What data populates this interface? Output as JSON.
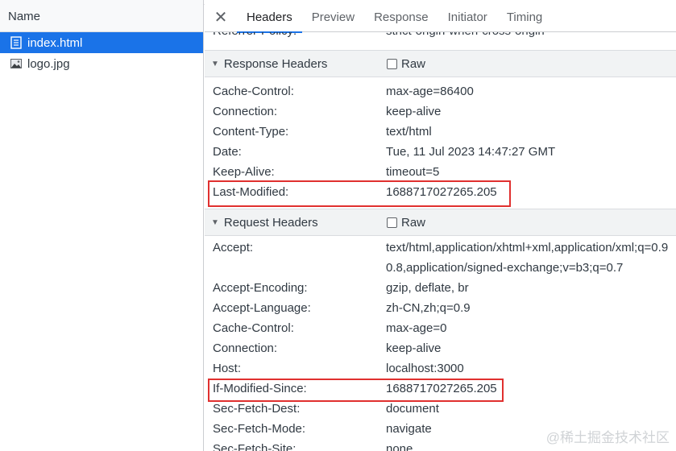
{
  "files": {
    "column_label": "Name",
    "items": [
      {
        "name": "index.html",
        "icon": "document-icon",
        "selected": true
      },
      {
        "name": "logo.jpg",
        "icon": "image-icon",
        "selected": false
      }
    ]
  },
  "tabs": {
    "close_label": "✕",
    "items": [
      "Headers",
      "Preview",
      "Response",
      "Initiator",
      "Timing"
    ],
    "active": "Headers"
  },
  "partial_row": {
    "key": "Referrer-Policy:",
    "value": "strict-origin-when-cross-origin"
  },
  "response_headers": {
    "title": "Response Headers",
    "raw_label": "Raw",
    "rows": [
      {
        "k": "Cache-Control:",
        "v": "max-age=86400"
      },
      {
        "k": "Connection:",
        "v": "keep-alive"
      },
      {
        "k": "Content-Type:",
        "v": "text/html"
      },
      {
        "k": "Date:",
        "v": "Tue, 11 Jul 2023 14:47:27 GMT"
      },
      {
        "k": "Keep-Alive:",
        "v": "timeout=5"
      },
      {
        "k": "Last-Modified:",
        "v": "1688717027265.205"
      }
    ]
  },
  "request_headers": {
    "title": "Request Headers",
    "raw_label": "Raw",
    "rows": [
      {
        "k": "Accept:",
        "v": "text/html,application/xhtml+xml,application/xml;q=0.9"
      },
      {
        "k": "",
        "v": "0.8,application/signed-exchange;v=b3;q=0.7"
      },
      {
        "k": "Accept-Encoding:",
        "v": "gzip, deflate, br"
      },
      {
        "k": "Accept-Language:",
        "v": "zh-CN,zh;q=0.9"
      },
      {
        "k": "Cache-Control:",
        "v": "max-age=0"
      },
      {
        "k": "Connection:",
        "v": "keep-alive"
      },
      {
        "k": "Host:",
        "v": "localhost:3000"
      },
      {
        "k": "If-Modified-Since:",
        "v": "1688717027265.205"
      },
      {
        "k": "Sec-Fetch-Dest:",
        "v": "document"
      },
      {
        "k": "Sec-Fetch-Mode:",
        "v": "navigate"
      },
      {
        "k": "Sec-Fetch-Site:",
        "v": "none"
      }
    ]
  },
  "watermark": "@稀土掘金技术社区",
  "colors": {
    "accent": "#1a73e8",
    "highlight_box": "#e0302f"
  }
}
